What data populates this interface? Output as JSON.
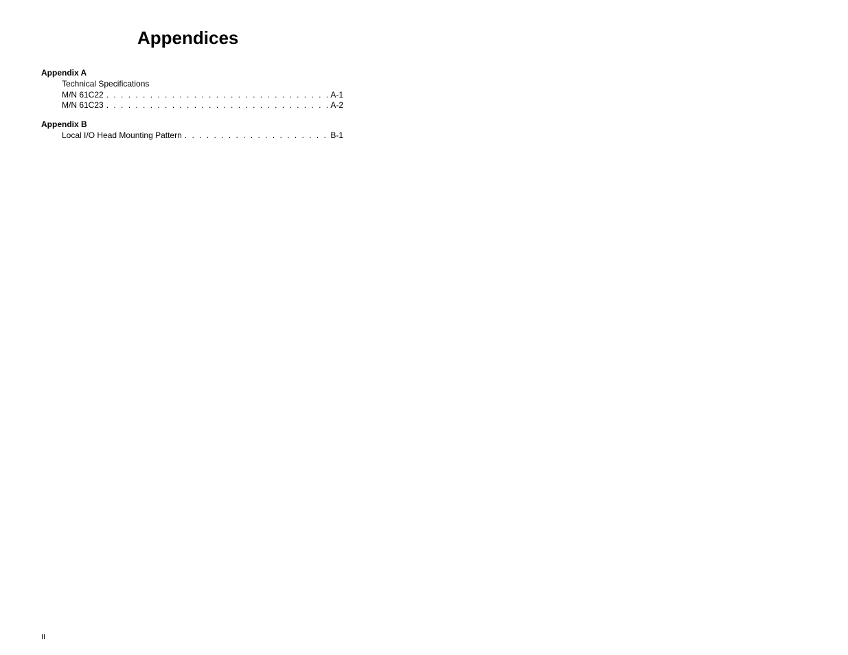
{
  "title": "Appendices",
  "appendix_a": {
    "heading": "Appendix A",
    "sub_heading": "Technical Specifications",
    "items": [
      {
        "label": "M/N 61C22",
        "page": "A-1"
      },
      {
        "label": "M/N 61C23",
        "page": "A-2"
      }
    ]
  },
  "appendix_b": {
    "heading": "Appendix B",
    "items": [
      {
        "label": "Local I/O Head Mounting Pattern",
        "page": "B-1"
      }
    ]
  },
  "page_number": "II"
}
